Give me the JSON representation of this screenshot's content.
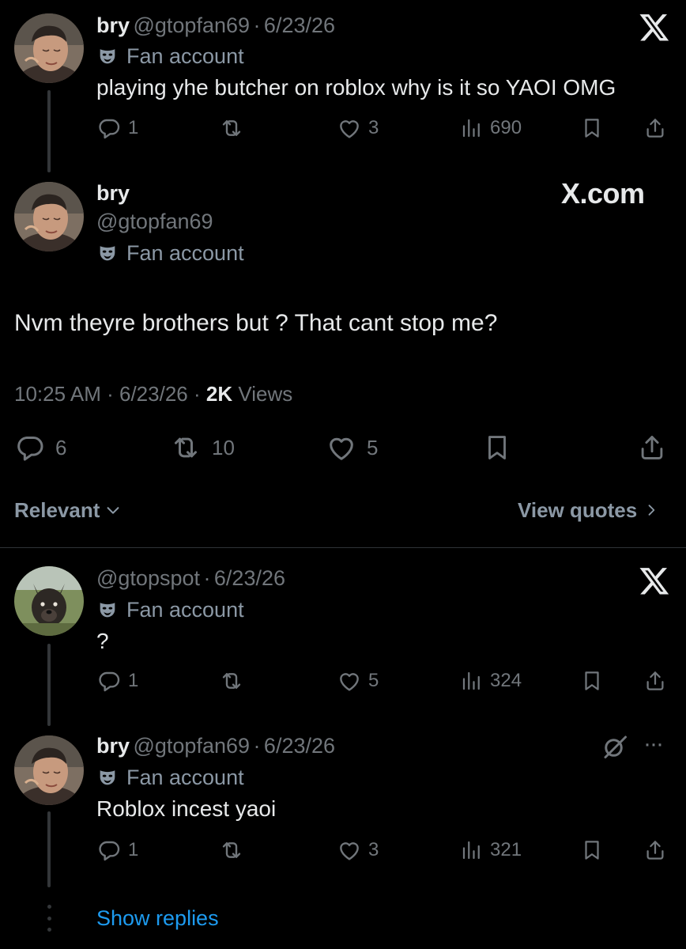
{
  "tweet1": {
    "name": "bry",
    "handle": "@gtopfan69",
    "date": "6/23/26",
    "badge": "Fan account",
    "text": "playing yhe butcher on roblox why is it so YAOI OMG",
    "replies": "1",
    "likes": "3",
    "views": "690"
  },
  "main": {
    "name": "bry",
    "handle": "@gtopfan69",
    "badge": "Fan account",
    "site_label": "X.com",
    "text": "Nvm theyre brothers but ? That cant stop me?",
    "time": "10:25 AM",
    "date": "6/23/26",
    "views_count": "2K",
    "views_label": "Views",
    "replies": "6",
    "reposts": "10",
    "likes": "5"
  },
  "filter": {
    "sort_label": "Relevant",
    "quotes_label": "View quotes"
  },
  "reply1": {
    "handle": "@gtopspot",
    "date": "6/23/26",
    "badge": "Fan account",
    "text": "?",
    "replies": "1",
    "likes": "5",
    "views": "324"
  },
  "reply2": {
    "name": "bry",
    "handle": "@gtopfan69",
    "date": "6/23/26",
    "badge": "Fan account",
    "text": "Roblox incest yaoi",
    "replies": "1",
    "likes": "3",
    "views": "321"
  },
  "show_replies": "Show replies",
  "colors": {
    "background": "#000000",
    "text": "#e7e9ea",
    "muted": "#71767b",
    "link": "#1d9bf0",
    "divider": "#2f3336"
  }
}
